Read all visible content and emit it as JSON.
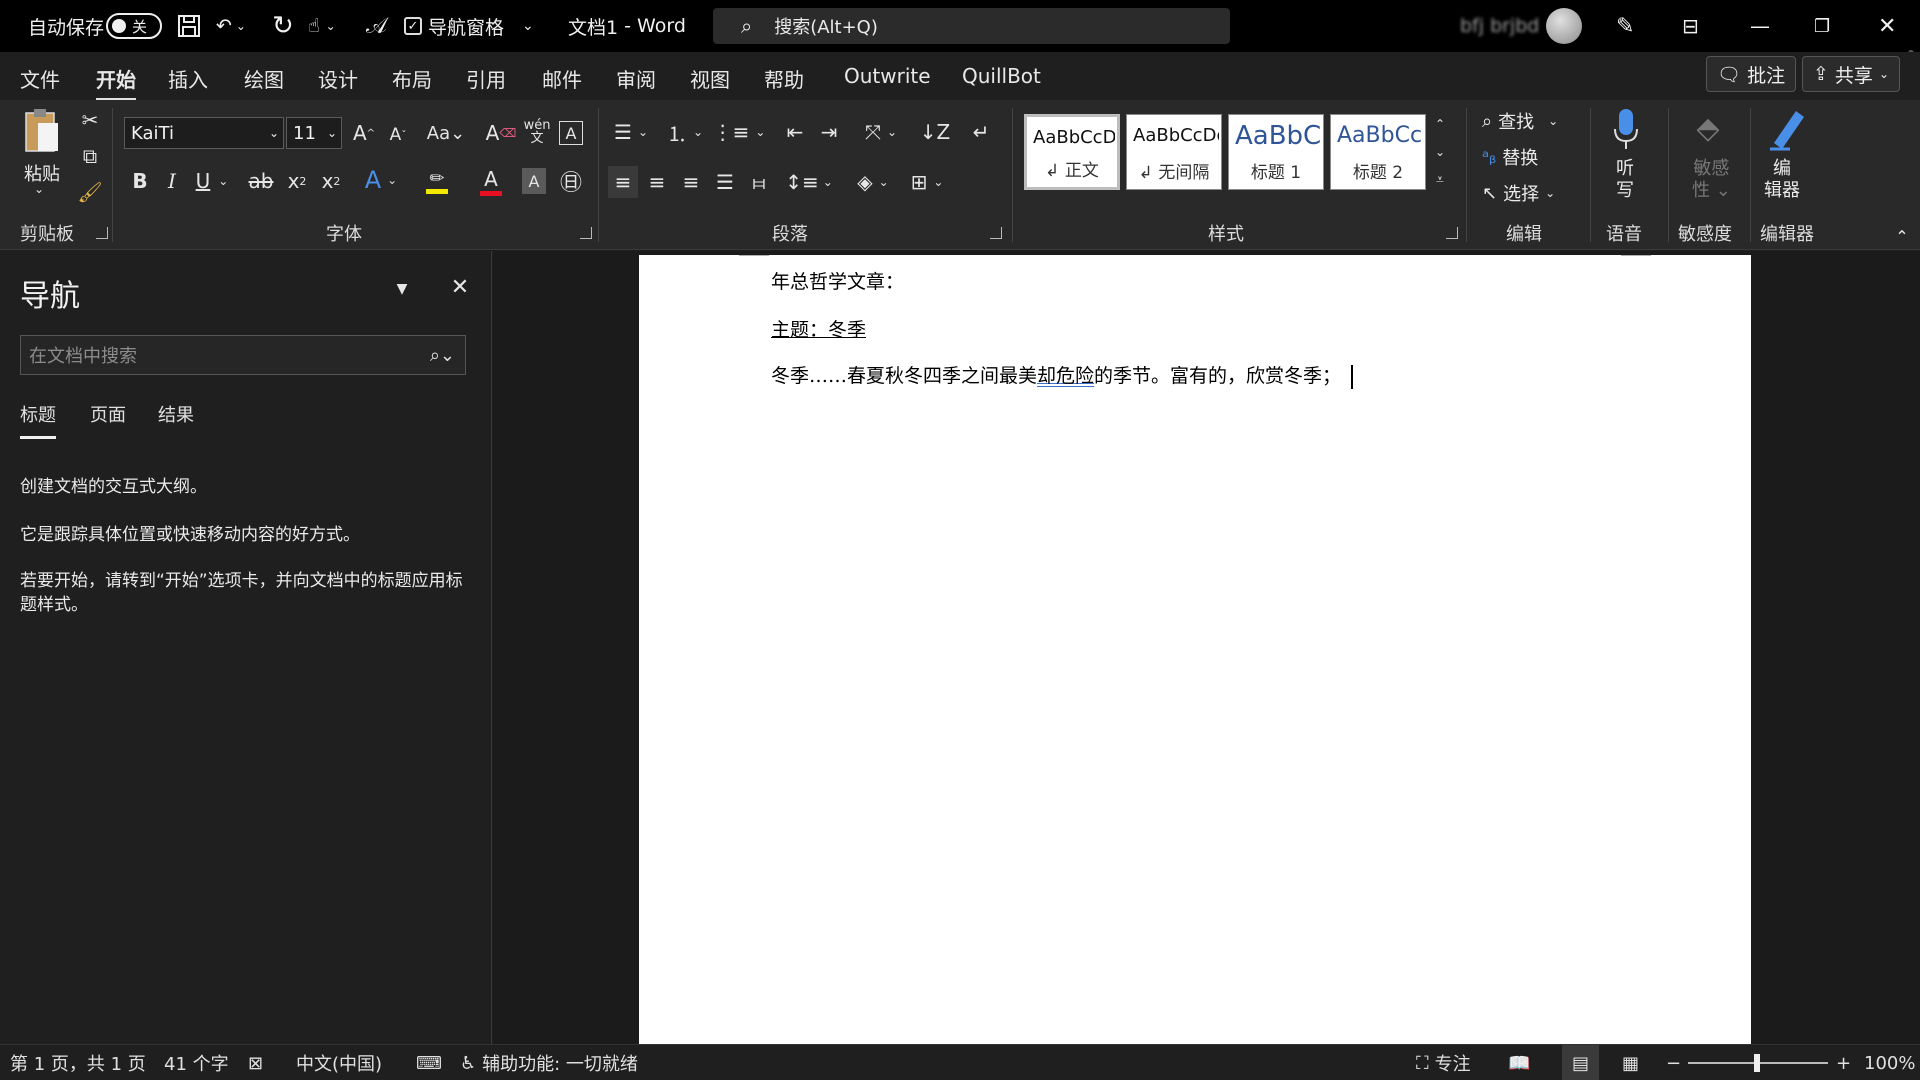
{
  "titlebar": {
    "autosave_label": "自动保存",
    "autosave_state": "关",
    "nav_pane_label": "导航窗格",
    "doc_title": "文档1",
    "app_name": "Word",
    "title_sep": "-",
    "search_placeholder": "搜索(Alt+Q)",
    "user_name": "bfj brjbd"
  },
  "tabs": [
    "文件",
    "开始",
    "插入",
    "绘图",
    "设计",
    "布局",
    "引用",
    "邮件",
    "审阅",
    "视图",
    "帮助",
    "Outwrite",
    "QuillBot"
  ],
  "active_tab": "开始",
  "actions": {
    "comments": "批注",
    "share": "共享"
  },
  "ribbon": {
    "clipboard": {
      "paste": "粘贴",
      "label": "剪贴板"
    },
    "font": {
      "name": "KaiTi",
      "size": "11",
      "label": "字体"
    },
    "paragraph": {
      "label": "段落"
    },
    "styles": {
      "label": "样式",
      "items": [
        {
          "sample": "AaBbCcDd",
          "name": "正文"
        },
        {
          "sample": "AaBbCcDd",
          "name": "无间隔"
        },
        {
          "sample": "AaBbCc",
          "name": "标题 1"
        },
        {
          "sample": "AaBbCcD",
          "name": "标题 2"
        }
      ]
    },
    "editing": {
      "find": "查找",
      "replace": "替换",
      "select": "选择",
      "label": "编辑"
    },
    "voice": {
      "dictate_1": "听",
      "dictate_2": "写",
      "label": "语音"
    },
    "sensitivity": {
      "btn_1": "敏感",
      "btn_2": "性",
      "label": "敏感度"
    },
    "editor": {
      "btn_1": "编",
      "btn_2": "辑器",
      "label": "编辑器"
    }
  },
  "nav": {
    "title": "导航",
    "search_placeholder": "在文档中搜索",
    "tabs": [
      "标题",
      "页面",
      "结果"
    ],
    "text1": "创建文档的交互式大纲。",
    "text2": "它是跟踪具体位置或快速移动内容的好方式。",
    "text3": "若要开始，请转到“开始”选项卡，并向文档中的标题应用标题样式。"
  },
  "document": {
    "line1": "年总哲学文章：",
    "line2": "主题：冬季",
    "line3_a": "冬季……春夏秋冬四季之间最美",
    "line3_b": "却危险",
    "line3_c": "的季节。富有的，欣赏冬季；"
  },
  "status": {
    "page": "第 1 页，共 1 页",
    "words": "41 个字",
    "language": "中文(中国)",
    "accessibility": "辅助功能: 一切就绪",
    "focus": "专注",
    "zoom": "100%",
    "zoom_level": 100
  },
  "colors": {
    "highlight": "#f5e800",
    "font_color": "#e81123",
    "accent_blue": "#4a8fe7"
  }
}
